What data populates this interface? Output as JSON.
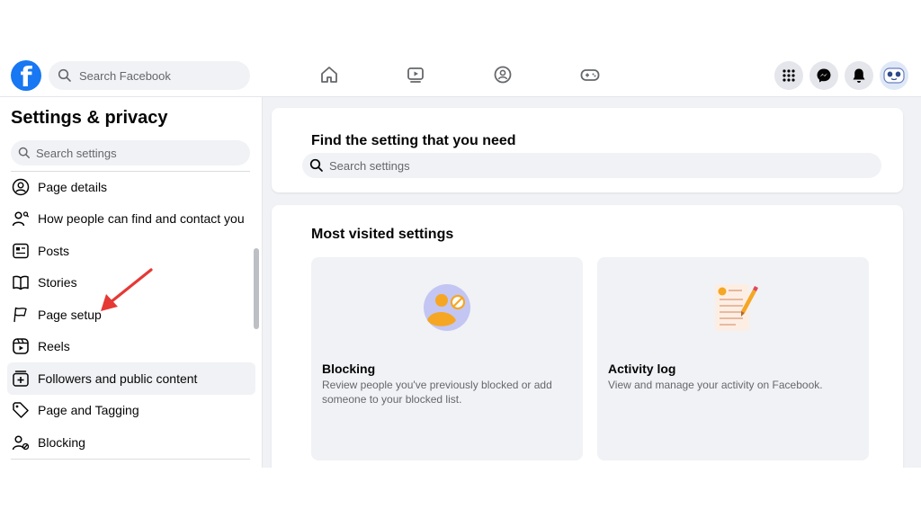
{
  "topbar": {
    "search_placeholder": "Search Facebook",
    "nav_icons": [
      "home-icon",
      "watch-icon",
      "groups-icon",
      "gaming-icon"
    ],
    "right_icons": [
      "menu-grid-icon",
      "messenger-icon",
      "bell-icon",
      "avatar"
    ]
  },
  "sidebar": {
    "title": "Settings & privacy",
    "search_placeholder": "Search settings",
    "items": [
      {
        "label": "Page details",
        "icon": "user-circle-icon"
      },
      {
        "label": "How people can find and contact you",
        "icon": "person-search-icon"
      },
      {
        "label": "Posts",
        "icon": "posts-icon"
      },
      {
        "label": "Stories",
        "icon": "stories-icon"
      },
      {
        "label": "Page setup",
        "icon": "flag-icon"
      },
      {
        "label": "Reels",
        "icon": "reels-icon"
      },
      {
        "label": "Followers and public content",
        "icon": "followers-icon"
      },
      {
        "label": "Page and Tagging",
        "icon": "tag-icon"
      },
      {
        "label": "Blocking",
        "icon": "blocking-person-icon"
      }
    ]
  },
  "main": {
    "find": {
      "heading": "Find the setting that you need",
      "search_placeholder": "Search settings"
    },
    "most_visited": {
      "heading": "Most visited settings",
      "tiles": [
        {
          "title": "Blocking",
          "description": "Review people you've previously blocked or add someone to your blocked list.",
          "icon": "blocking-illustration"
        },
        {
          "title": "Activity log",
          "description": "View and manage your activity on Facebook.",
          "icon": "activity-log-illustration"
        }
      ]
    }
  },
  "colors": {
    "brand": "#1877f2",
    "annotation_arrow": "#e53935",
    "illustration_orange": "#f5a623",
    "illustration_purple": "#c3c6f2"
  }
}
